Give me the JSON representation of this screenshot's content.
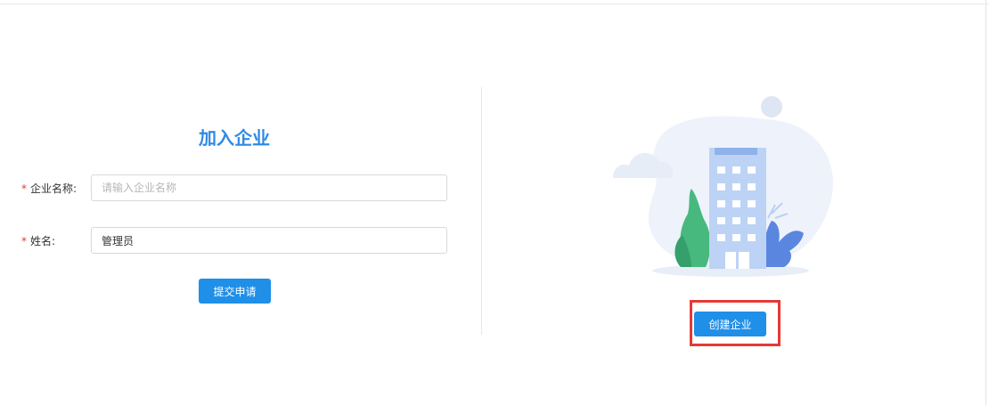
{
  "join_form": {
    "title": "加入企业",
    "company_field": {
      "label": "企业名称:",
      "required_mark": "*",
      "value": "",
      "placeholder": "请输入企业名称"
    },
    "name_field": {
      "label": "姓名:",
      "required_mark": "*",
      "value": "管理员",
      "placeholder": ""
    },
    "submit_label": "提交申请"
  },
  "create_panel": {
    "illustration_icon": "office-building-icon",
    "create_label": "创建企业"
  },
  "colors": {
    "accent": "#1f8fe8",
    "title": "#2f8ae6",
    "required": "#e53935",
    "highlight": "#e53935"
  }
}
